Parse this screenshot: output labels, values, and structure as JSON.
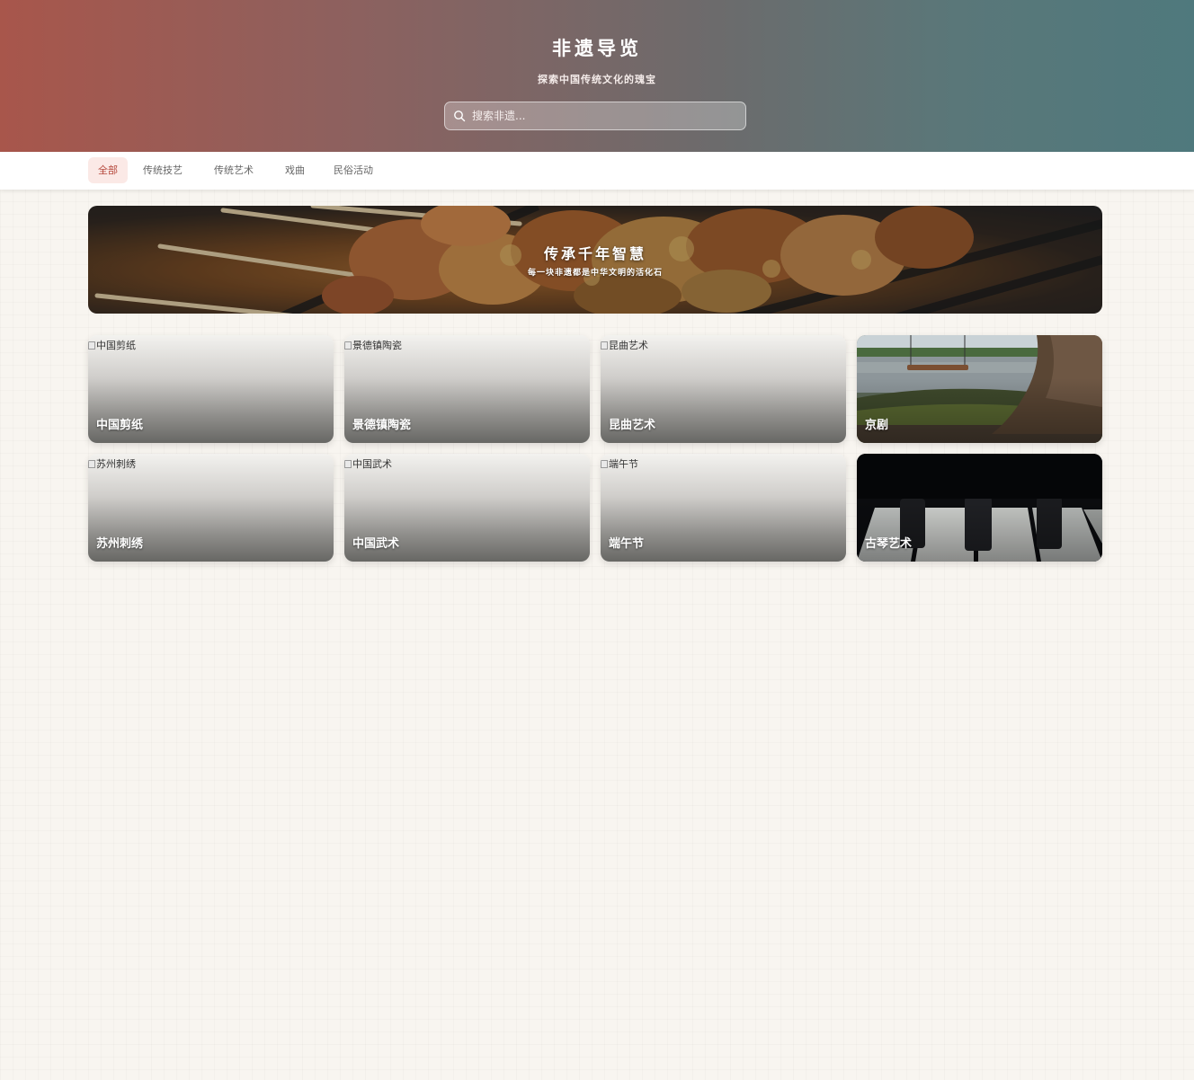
{
  "header": {
    "title": "非遗导览",
    "subtitle": "探索中国传统文化的瑰宝",
    "search_placeholder": "搜索非遗..."
  },
  "nav": {
    "tabs": [
      {
        "label": "全部",
        "active": true
      },
      {
        "label": "传统技艺",
        "active": false
      },
      {
        "label": "传统艺术",
        "active": false
      },
      {
        "label": "戏曲",
        "active": false
      },
      {
        "label": "民俗活动",
        "active": false
      }
    ]
  },
  "banner": {
    "title": "传承千年智慧",
    "subtitle": "每一块非遗都是中华文明的活化石"
  },
  "cards": [
    {
      "name": "中国剪纸",
      "alt": "中国剪纸",
      "image_loaded": false
    },
    {
      "name": "景德镇陶瓷",
      "alt": "景德镇陶瓷",
      "image_loaded": false
    },
    {
      "name": "昆曲艺术",
      "alt": "昆曲艺术",
      "image_loaded": false
    },
    {
      "name": "京剧",
      "alt": "京剧",
      "image_loaded": true
    },
    {
      "name": "苏州刺绣",
      "alt": "苏州刺绣",
      "image_loaded": false
    },
    {
      "name": "中国武术",
      "alt": "中国武术",
      "image_loaded": false
    },
    {
      "name": "端午节",
      "alt": "端午节",
      "image_loaded": false
    },
    {
      "name": "古琴艺术",
      "alt": "古琴艺术",
      "image_loaded": true
    }
  ],
  "colors": {
    "accent": "#b5473b",
    "header_start": "#a8564b",
    "header_end": "#4f797d",
    "page_bg": "#f8f5f0"
  }
}
